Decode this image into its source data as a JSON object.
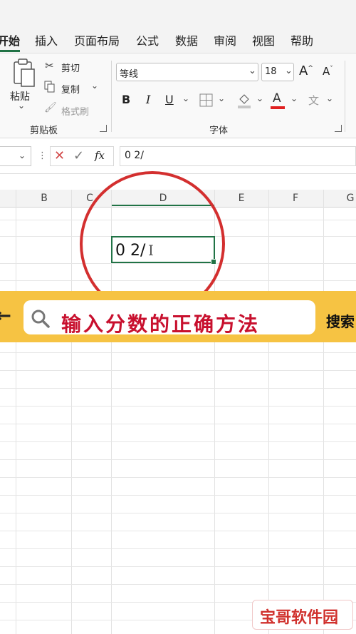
{
  "tabs": [
    "开始",
    "插入",
    "页面布局",
    "公式",
    "数据",
    "审阅",
    "视图",
    "帮助"
  ],
  "clipboard": {
    "paste": "粘贴",
    "cut": "剪切",
    "copy": "复制",
    "format_painter": "格式刷",
    "group_label": "剪贴板"
  },
  "font": {
    "name": "等线",
    "size": "18",
    "grow": "A",
    "shrink": "A",
    "bold": "B",
    "italic": "I",
    "underline": "U",
    "color_letter": "A",
    "group_label": "字体"
  },
  "formula_bar": {
    "fx": "fx",
    "content": "0 2/"
  },
  "columns": [
    "B",
    "C",
    "D",
    "E",
    "F",
    "G"
  ],
  "active_cell": {
    "column": "D",
    "value": "0 2/"
  },
  "banner": {
    "title": "输入分数的正确方法",
    "right_text": "搜索"
  },
  "watermark": "宝哥软件园",
  "colors": {
    "excel_green": "#217346",
    "circle_red": "#d32f2f",
    "banner_yellow": "#f6c343",
    "banner_text": "#c8102e",
    "font_color_bar": "#e02020"
  }
}
